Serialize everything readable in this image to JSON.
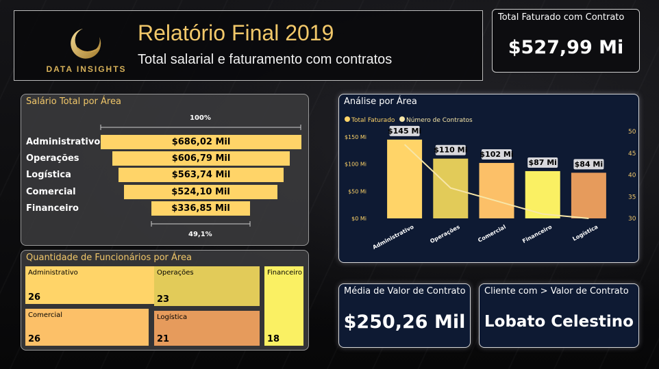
{
  "header": {
    "logo_text": "DATA INSIGHTS",
    "title": "Relatório Final 2019",
    "subtitle": "Total salarial e faturamento com contratos"
  },
  "kpi_total": {
    "label": "Total Faturado com Contrato",
    "value": "$527,99 Mi"
  },
  "salary_panel": {
    "title": "Salário Total por Área",
    "top_pct": "100%",
    "bottom_pct": "49,1%",
    "rows": [
      {
        "area": "Administrativo",
        "value_label": "$686,02 Mil",
        "value": 686.02
      },
      {
        "area": "Operações",
        "value_label": "$606,79 Mil",
        "value": 606.79
      },
      {
        "area": "Logística",
        "value_label": "$563,74 Mil",
        "value": 563.74
      },
      {
        "area": "Comercial",
        "value_label": "$524,10 Mil",
        "value": 524.1
      },
      {
        "area": "Financeiro",
        "value_label": "$336,85 Mil",
        "value": 336.85
      }
    ]
  },
  "employees_panel": {
    "title": "Quantidade de Funcionários por Área",
    "cells": [
      {
        "area": "Administrativo",
        "count": "26",
        "color": "#ffd468"
      },
      {
        "area": "Operações",
        "count": "23",
        "color": "#e2cb59"
      },
      {
        "area": "Financeiro",
        "count": "18",
        "color": "#faf063"
      },
      {
        "area": "Comercial",
        "count": "26",
        "color": "#fcc068"
      },
      {
        "area": "Logística",
        "count": "21",
        "color": "#e69b5c"
      }
    ]
  },
  "analysis_panel": {
    "title": "Análise por Área",
    "legend": {
      "series1": "Total Faturado",
      "series2": "Número de Contratos"
    }
  },
  "chart_data": {
    "type": "bar",
    "title": "Análise por Área",
    "categories": [
      "Administrativo",
      "Operações",
      "Comercial",
      "Financeiro",
      "Logística"
    ],
    "series": [
      {
        "name": "Total Faturado",
        "axis": "left",
        "values": [
          145,
          110,
          102,
          87,
          84
        ],
        "labels": [
          "$145 Mi",
          "$110 Mi",
          "$102 Mi",
          "$87 Mi",
          "$84 Mi"
        ],
        "colors": [
          "#ffd468",
          "#e2cb59",
          "#fcc068",
          "#faf063",
          "#e69b5c"
        ]
      },
      {
        "name": "Número de Contratos",
        "axis": "right",
        "type": "line",
        "values": [
          47,
          37,
          34,
          31,
          30
        ],
        "color": "#f7e6a8"
      }
    ],
    "y_left": {
      "ticks": [
        "$0 Mi",
        "$50 Mi",
        "$100 Mi",
        "$150 Mi"
      ],
      "ylim": [
        0,
        160
      ]
    },
    "y_right": {
      "ticks": [
        "30",
        "35",
        "40",
        "45",
        "50"
      ],
      "ylim": [
        30,
        50
      ]
    },
    "legend_position": "top-left"
  },
  "kpi_avg": {
    "label": "Média de Valor de Contrato",
    "value": "$250,26 Mil"
  },
  "kpi_client": {
    "label": "Cliente com > Valor de Contrato",
    "value": "Lobato Celestino"
  }
}
